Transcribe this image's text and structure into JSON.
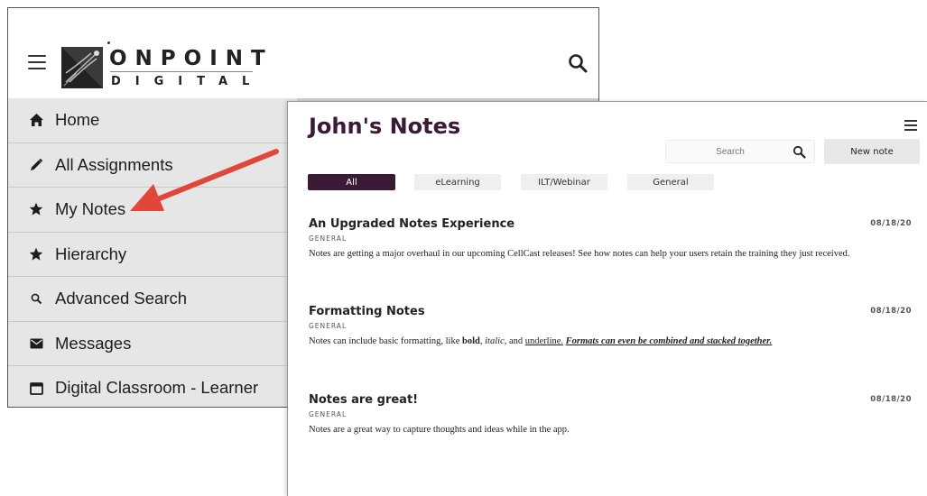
{
  "left_app": {
    "logo": {
      "top": "ONPOINT",
      "bottom": "DIGITAL"
    },
    "nav": [
      {
        "label": "Home",
        "icon": "home-icon"
      },
      {
        "label": "All Assignments",
        "icon": "pencil-icon"
      },
      {
        "label": "My Notes",
        "icon": "star-icon"
      },
      {
        "label": "Hierarchy",
        "icon": "star-icon"
      },
      {
        "label": "Advanced Search",
        "icon": "search-icon"
      },
      {
        "label": "Messages",
        "icon": "envelope-icon"
      },
      {
        "label": "Digital Classroom - Learner",
        "icon": "calendar-icon"
      }
    ]
  },
  "right_app": {
    "title": "John's Notes",
    "search_placeholder": "Search",
    "new_note_label": "New note",
    "filters": [
      {
        "label": "All",
        "active": true
      },
      {
        "label": "eLearning",
        "active": false
      },
      {
        "label": "ILT/Webinar",
        "active": false
      },
      {
        "label": "General",
        "active": false
      }
    ],
    "notes": [
      {
        "title": "An Upgraded Notes Experience",
        "date": "08/18/20",
        "category": "GENERAL",
        "body": "Notes are getting a major overhaul in our upcoming CellCast releases! See how notes can help your users retain the training they just received."
      },
      {
        "title": "Formatting Notes",
        "date": "08/18/20",
        "category": "GENERAL",
        "body_parts": {
          "p1": "Notes can include basic formatting, like ",
          "bold": "bold",
          "p2": ", ",
          "italic": "italic",
          "p3": ", and ",
          "underline": "underline.",
          "p4": " ",
          "combo": "Formats can even be combined and stacked together."
        }
      },
      {
        "title": "Notes are great!",
        "date": "08/18/20",
        "category": "GENERAL",
        "body": "Notes are a great way to capture thoughts and ideas while in the app."
      }
    ]
  },
  "colors": {
    "brand_purple": "#3b1a37",
    "arrow_red": "#e0463a",
    "nav_bg": "#e6e6e6"
  }
}
